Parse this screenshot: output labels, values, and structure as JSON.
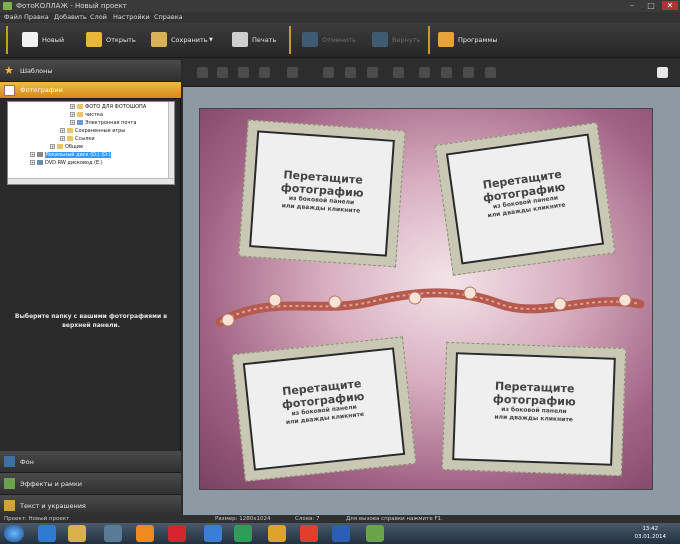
{
  "window": {
    "title": "ФотоКОЛЛАЖ - Новый проект"
  },
  "menu": [
    "Файл",
    "Правка",
    "Добавить",
    "Слой",
    "Настройки",
    "Справка"
  ],
  "toolbar": {
    "new_label": "Новый",
    "open_label": "Открыть",
    "save_label": "Сохранить",
    "print_label": "Печать",
    "undo_label": "Отменить",
    "redo_label": "Вернуть",
    "programs_label": "Программы"
  },
  "left_panel": {
    "templates_label": "Шаблоны",
    "photos_label": "Фотографии",
    "tree": [
      "ФОТО ДЛЯ ФОТОШОПА",
      "чистка",
      "Электронная почта",
      "Сохраненные игры",
      "Ссылки",
      "Общие",
      "Локальный диск (D:) (D:)",
      "DVD RW дисковод (E:)"
    ],
    "hint": "Выберите папку с вашими фотографиями в верхней панели.",
    "background_label": "Фон",
    "effects_label": "Эффекты и рамки",
    "text_label": "Текст и украшения"
  },
  "placeholder": {
    "line1": "Перетащите",
    "line2": "фотографию",
    "line3": "из боковой панели",
    "line4": "или дважды кликните"
  },
  "status": {
    "project": "Проект: Новый проект",
    "size": "Размер: 1280x1024",
    "layers": "Слоев: 7",
    "help": "Для вызова справки нажмите F1."
  },
  "taskbar": {
    "time": "13:42",
    "date": "03.01.2014"
  },
  "colors": {
    "accent": "#e9a02d",
    "workspace": "#8e9aa3",
    "frame": "#c9c8b5"
  }
}
